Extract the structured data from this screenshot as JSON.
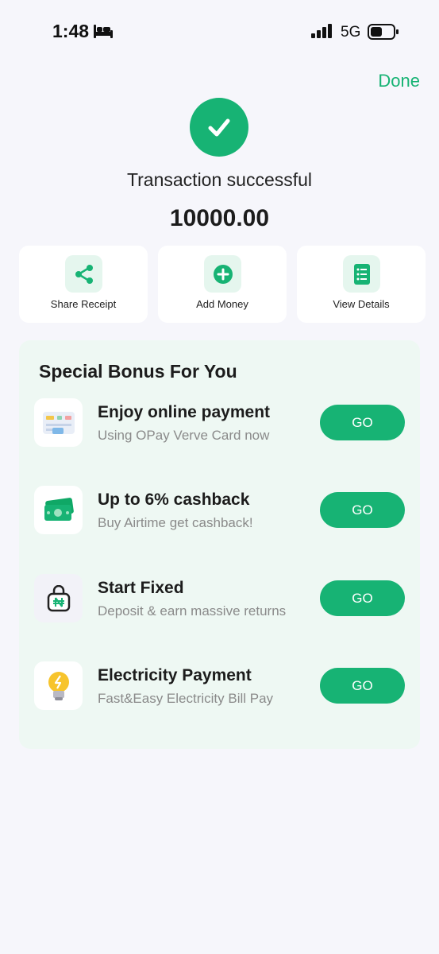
{
  "status_bar": {
    "time": "1:48",
    "network": "5G"
  },
  "header": {
    "done_label": "Done"
  },
  "transaction": {
    "status": "Transaction successful",
    "amount": "10000.00"
  },
  "actions": [
    {
      "label": "Share Receipt",
      "icon": "share-icon"
    },
    {
      "label": "Add Money",
      "icon": "plus-circle-icon"
    },
    {
      "label": "View Details",
      "icon": "document-list-icon"
    }
  ],
  "bonus": {
    "title": "Special Bonus For You",
    "items": [
      {
        "title": "Enjoy online payment",
        "subtitle": "Using OPay Verve Card now",
        "button": "GO",
        "icon": "card-payment-icon"
      },
      {
        "title": "Up to 6% cashback",
        "subtitle": "Buy Airtime get cashback!",
        "button": "GO",
        "icon": "cash-icon"
      },
      {
        "title": "Start Fixed",
        "subtitle": "Deposit & earn massive returns",
        "button": "GO",
        "icon": "naira-lock-icon"
      },
      {
        "title": "Electricity Payment",
        "subtitle": "Fast&Easy Electricity Bill Pay",
        "button": "GO",
        "icon": "light-bulb-icon"
      }
    ]
  },
  "colors": {
    "accent": "#17b374",
    "background": "#f6f6fb",
    "panel": "#eef8f3"
  }
}
